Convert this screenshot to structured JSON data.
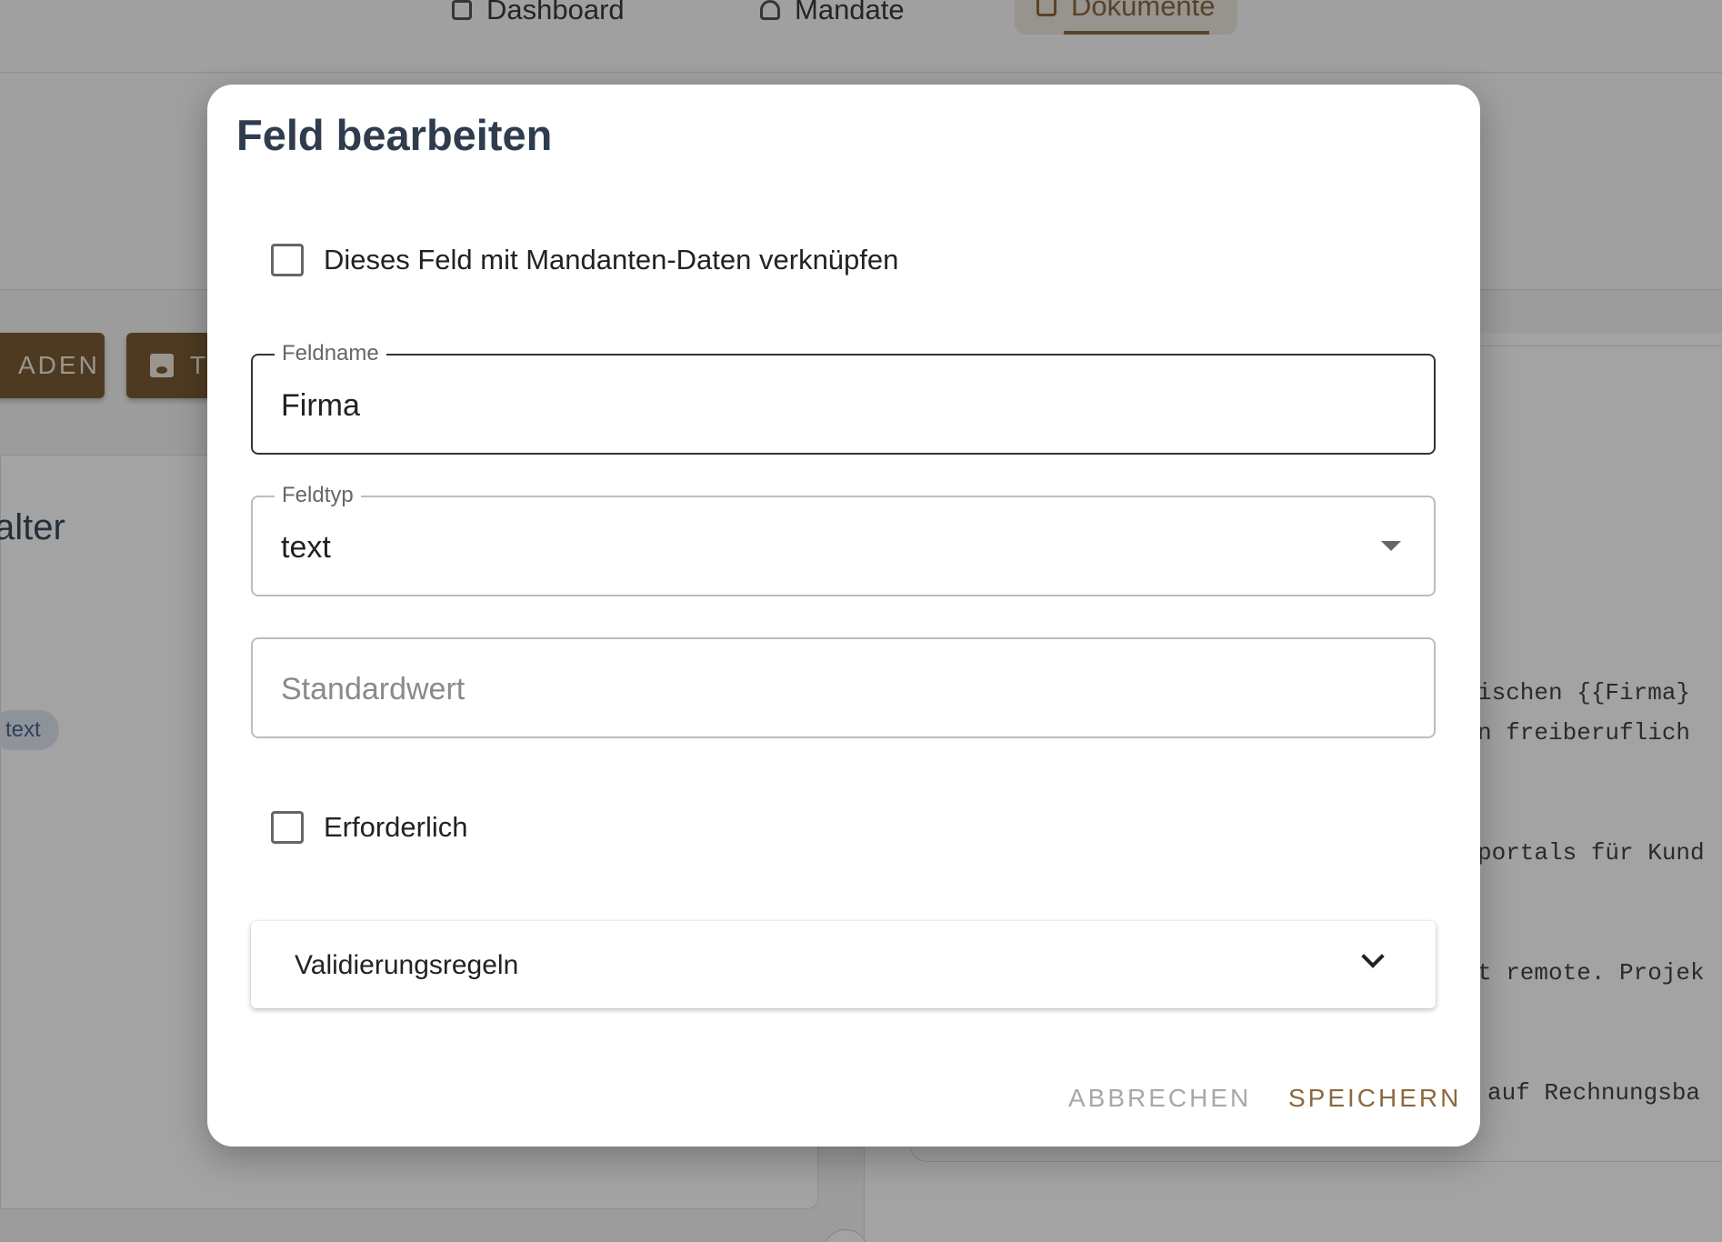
{
  "nav": {
    "items": [
      {
        "label": "Dashboard",
        "icon": "dashboard-icon"
      },
      {
        "label": "Mandate",
        "icon": "person-icon"
      },
      {
        "label": "Dokumente",
        "icon": "document-icon"
      }
    ]
  },
  "toolbar": {
    "load_label": "ADEN",
    "save_label": "T"
  },
  "left": {
    "title": "alter",
    "chip": "text"
  },
  "preview": {
    "lines": [
      "ischen {{Firma}",
      "n freiberuflich",
      "portals für Kund",
      "t remote. Projek",
      "auf Rechnungsba"
    ]
  },
  "dialog": {
    "title": "Feld bearbeiten",
    "link_checkbox_label": "Dieses Feld mit Mandanten-Daten verknüpfen",
    "fieldname": {
      "label": "Feldname",
      "value": "Firma"
    },
    "fieldtype": {
      "label": "Feldtyp",
      "value": "text"
    },
    "default": {
      "placeholder": "Standardwert"
    },
    "required_label": "Erforderlich",
    "validation_label": "Validierungsregeln",
    "cancel_label": "ABBRECHEN",
    "save_label": "SPEICHERN"
  },
  "colors": {
    "accent": "#8b6a3e",
    "brown_button": "#7a5c35",
    "title": "#2e3c4e"
  }
}
